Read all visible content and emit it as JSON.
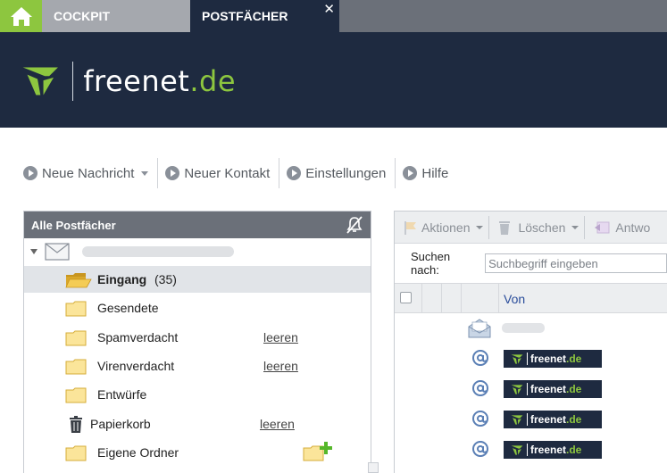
{
  "tabs": {
    "home_icon": "home-icon",
    "cockpit": "COCKPIT",
    "postfaecher": "POSTFÄCHER",
    "close": "✕"
  },
  "brand": {
    "name": "freenet",
    "tld": ".de",
    "accent": "#8dc63f",
    "dark": "#1e2a40"
  },
  "toolbar": {
    "new_message": "Neue Nachricht",
    "new_contact": "Neuer Kontakt",
    "settings": "Einstellungen",
    "help": "Hilfe"
  },
  "folders": {
    "header": "Alle Postfächer",
    "items": [
      {
        "label": "Eingang",
        "count": "(35)",
        "selected": true,
        "action": ""
      },
      {
        "label": "Gesendete",
        "count": "",
        "action": ""
      },
      {
        "label": "Spamverdacht",
        "count": "",
        "action": "leeren"
      },
      {
        "label": "Virenverdacht",
        "count": "",
        "action": "leeren"
      },
      {
        "label": "Entwürfe",
        "count": "",
        "action": ""
      },
      {
        "label": "Papierkorb",
        "count": "",
        "action": "leeren"
      },
      {
        "label": "Eigene Ordner",
        "count": "",
        "action": ""
      }
    ]
  },
  "messages": {
    "toolbar": {
      "actions": "Aktionen",
      "delete": "Löschen",
      "reply": "Antwo"
    },
    "search": {
      "label": "Suchen nach:",
      "placeholder": "Suchbegriff eingeben"
    },
    "columns": {
      "from": "Von"
    },
    "rows": [
      {
        "type": "newsletter"
      },
      {
        "type": "freenet",
        "sender": "freenet",
        "tld": ".de"
      },
      {
        "type": "freenet",
        "sender": "freenet",
        "tld": ".de"
      },
      {
        "type": "freenet",
        "sender": "freenet",
        "tld": ".de"
      },
      {
        "type": "freenet",
        "sender": "freenet",
        "tld": ".de"
      }
    ]
  }
}
